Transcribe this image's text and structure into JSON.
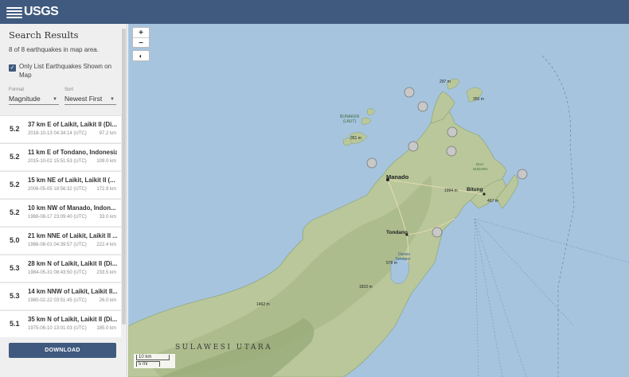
{
  "header": {
    "logo_text": "USGS"
  },
  "sidebar": {
    "title": "Search Results",
    "count_text": "8 of 8 earthquakes in map area.",
    "only_list_label": "Only List Earthquakes Shown on Map",
    "only_list_checked": true,
    "format": {
      "caption": "Format",
      "value": "Magnitude"
    },
    "sort": {
      "caption": "Sort",
      "value": "Newest First"
    },
    "download_label": "DOWNLOAD"
  },
  "earthquakes": [
    {
      "mag": "5.2",
      "place": "37 km E of Laikit, Laikit II (Di...",
      "time": "2018-10-13 04:34:14 (UTC)",
      "depth": "97.2 km"
    },
    {
      "mag": "5.2",
      "place": "11 km E of Tondano, Indonesia",
      "time": "2015-10-02 15:51:53 (UTC)",
      "depth": "109.0 km"
    },
    {
      "mag": "5.2",
      "place": "15 km NE of Laikit, Laikit II (...",
      "time": "2006-05-05 18:56:32 (UTC)",
      "depth": "172.9 km"
    },
    {
      "mag": "5.2",
      "place": "10 km NW of Manado, Indon...",
      "time": "1988-08-17 23:09:40 (UTC)",
      "depth": "33.0 km"
    },
    {
      "mag": "5.0",
      "place": "21 km NNE of Laikit, Laikit II ...",
      "time": "1988-08-01 04:39:57 (UTC)",
      "depth": "222.4 km"
    },
    {
      "mag": "5.3",
      "place": "28 km N of Laikit, Laikit II (Di...",
      "time": "1984-05-31 08:43:50 (UTC)",
      "depth": "233.5 km"
    },
    {
      "mag": "5.3",
      "place": "14 km NNW of Laikit, Laikit II...",
      "time": "1980-02-22 03:51:45 (UTC)",
      "depth": "26.0 km"
    },
    {
      "mag": "5.1",
      "place": "35 km N of Laikit, Laikit II (Di...",
      "time": "1975-06-10 13:01:03 (UTC)",
      "depth": "185.0 km"
    }
  ],
  "map": {
    "zoom_in": "+",
    "zoom_out": "−",
    "layers_icon": "globe-icon",
    "labels": {
      "manado": "Manado",
      "tondano": "Tondano",
      "bitung": "Bitung",
      "bunaken": "BUNAKEN",
      "bunaken_sub": "(LAUT)",
      "sulawesi": "SULAWESI UTARA",
      "duasudara": "DUA",
      "duasudara_sub": "SUDARA",
      "danau": "Danau",
      "danau_sub": "Tondano",
      "e1": "297 m",
      "e2": "355 m",
      "e3": "351 m",
      "e4": "1994 m",
      "e5": "467 m",
      "e6": "579 m",
      "e7": "1810 m",
      "e8": "1462 m"
    },
    "scale_km": "10 km",
    "scale_mi": "5 mi"
  },
  "colors": {
    "header": "#3f5a7e",
    "water": "#a6c4de",
    "land": "#b9c79a"
  }
}
